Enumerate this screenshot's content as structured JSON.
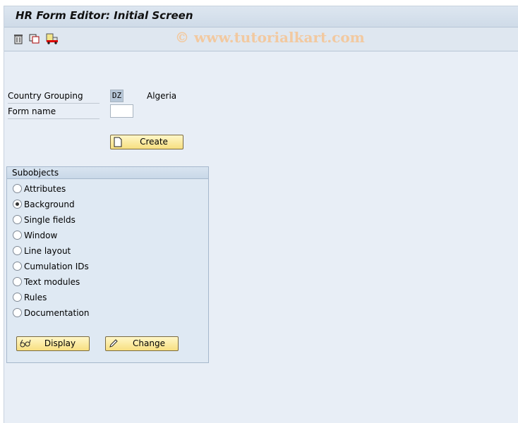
{
  "window": {
    "title": "HR Form Editor: Initial Screen"
  },
  "toolbar": {
    "icons": [
      "trash-icon",
      "copy-icon",
      "transport-truck-icon"
    ]
  },
  "watermark": "© www.tutorialkart.com",
  "form": {
    "country_grouping_label": "Country Grouping",
    "country_grouping_value": "DZ",
    "country_name": "Algeria",
    "form_name_label": "Form name",
    "form_name_value": "",
    "create_label": "Create"
  },
  "subobjects": {
    "title": "Subobjects",
    "selected": "Background",
    "options": [
      "Attributes",
      "Background",
      "Single fields",
      "Window",
      "Line layout",
      "Cumulation IDs",
      "Text modules",
      "Rules",
      "Documentation"
    ],
    "display_label": "Display",
    "change_label": "Change"
  }
}
